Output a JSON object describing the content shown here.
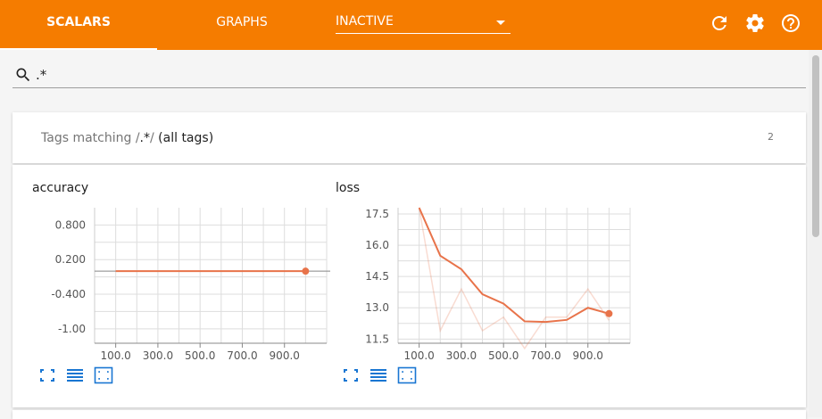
{
  "header": {
    "tabs": [
      {
        "label": "SCALARS",
        "active": true
      },
      {
        "label": "GRAPHS",
        "active": false
      }
    ],
    "run_select": "INACTIVE",
    "icons": [
      "refresh-icon",
      "settings-icon",
      "help-icon"
    ],
    "accent": "#f57c00"
  },
  "search": {
    "value": ".*",
    "icon": "search-icon"
  },
  "tag_group": {
    "prefix": "Tags matching /",
    "regex": ".*",
    "suffix": "/ ",
    "all": "(all tags)",
    "count": "2"
  },
  "charts": [
    {
      "title": "accuracy",
      "buttons": [
        "fullscreen-icon",
        "toggle-log-scale-icon",
        "fit-domain-icon"
      ]
    },
    {
      "title": "loss",
      "buttons": [
        "fullscreen-icon",
        "toggle-log-scale-icon",
        "fit-domain-icon"
      ]
    }
  ],
  "chart_data": [
    {
      "type": "line",
      "title": "accuracy",
      "x_ticks": [
        "100.0",
        "300.0",
        "500.0",
        "700.0",
        "900.0"
      ],
      "y_ticks": [
        "0.800",
        "0.200",
        "-0.400",
        "-1.00"
      ],
      "y_tick_values": [
        0.8,
        0.2,
        -0.4,
        -1.0
      ],
      "xlim": [
        0,
        1100
      ],
      "ylim": [
        -1.25,
        1.1
      ],
      "series": [
        {
          "x": [
            100,
            200,
            300,
            400,
            500,
            600,
            700,
            800,
            900,
            1000
          ],
          "values": [
            0,
            0,
            0,
            0,
            0,
            0,
            0,
            0,
            0,
            0
          ]
        }
      ],
      "color": "#e8734a",
      "grid": true
    },
    {
      "type": "line",
      "title": "loss",
      "x_ticks": [
        "100.0",
        "300.0",
        "500.0",
        "700.0",
        "900.0"
      ],
      "y_ticks": [
        "17.5",
        "16.0",
        "14.5",
        "13.0",
        "11.5"
      ],
      "y_tick_values": [
        17.5,
        16.0,
        14.5,
        13.0,
        11.5
      ],
      "xlim": [
        0,
        1100
      ],
      "ylim": [
        11.3,
        17.8
      ],
      "series": [
        {
          "x": [
            100,
            200,
            300,
            400,
            500,
            600,
            700,
            800,
            900,
            1000
          ],
          "values": [
            17.8,
            15.5,
            14.85,
            13.65,
            13.2,
            12.35,
            12.32,
            12.42,
            13.0,
            12.72
          ]
        },
        {
          "x": [
            100,
            200,
            300,
            400,
            500,
            600,
            700,
            800,
            900,
            1000
          ],
          "values": [
            17.8,
            11.9,
            13.9,
            11.9,
            12.55,
            11.05,
            12.55,
            12.55,
            13.9,
            12.4
          ]
        }
      ],
      "color": "#e8734a",
      "grid": true
    }
  ]
}
